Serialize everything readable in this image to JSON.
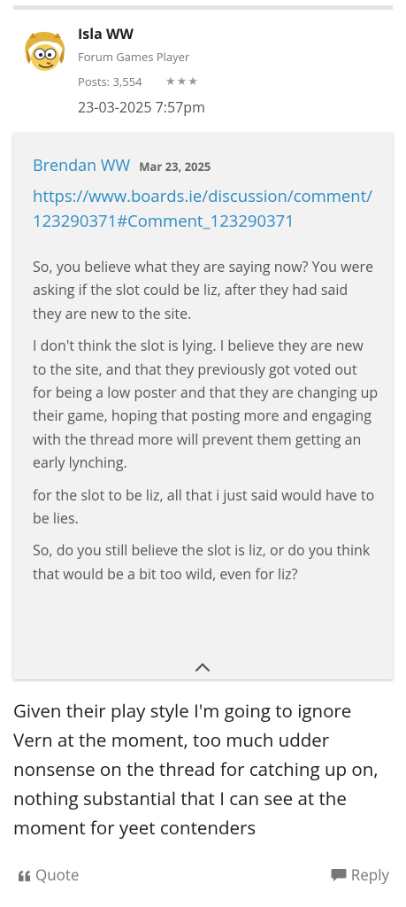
{
  "author": {
    "name": "Isla WW",
    "rank": "Forum Games Player",
    "posts": "Posts: 3,554",
    "stars": "★★★",
    "date": "23-03-2025 7:57pm"
  },
  "quote": {
    "author": "Brendan WW",
    "date": "Mar 23, 2025",
    "link": "https://www.boards.ie/discussion/comment/123290371#Comment_123290371",
    "paragraphs": [
      "So, you believe what they are saying now? You were asking if the slot could be liz, after they had said they are new to the site.",
      "I don't think the slot is lying. I believe they are new to the site, and that they previously got voted out for being a low poster and that they are changing up their game, hoping that posting more and engaging with the thread more will prevent them getting an early lynching.",
      "for the slot to be liz, all that i just said would have to be lies.",
      "So, do you still believe the slot is liz, or do you think that would be a bit too wild, even for liz?"
    ]
  },
  "post_text": "Given their play style I'm going to ignore Vern at the moment, too much udder nonsense on the thread for catching up on, nothing substantial that I can see at the moment for yeet contenders",
  "actions": {
    "quote_label": "Quote",
    "reply_label": "Reply"
  },
  "colors": {
    "link": "#2e8cc3",
    "quote_bg": "#f2f2f2",
    "muted": "#777777"
  },
  "icons": {
    "quote": "quote-marks-icon",
    "reply": "speech-bubble-icon",
    "collapse": "chevron-up-icon"
  }
}
